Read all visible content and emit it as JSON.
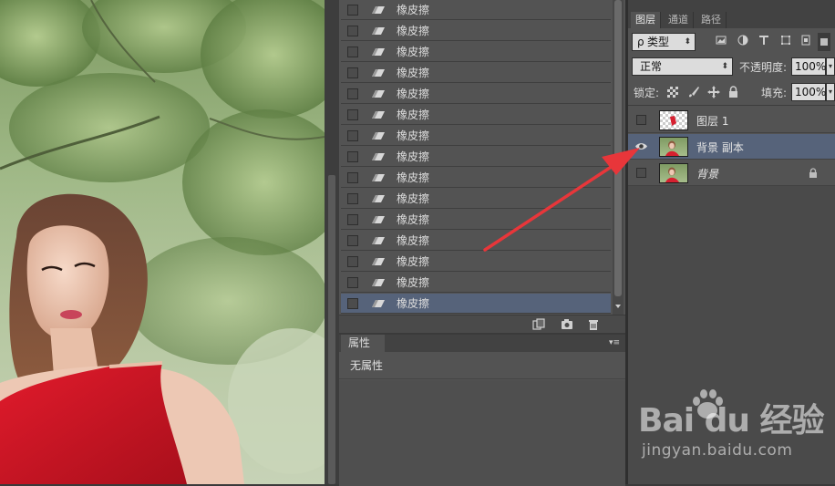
{
  "history": {
    "items": [
      {
        "label": "橡皮擦",
        "selected": false
      },
      {
        "label": "橡皮擦",
        "selected": false
      },
      {
        "label": "橡皮擦",
        "selected": false
      },
      {
        "label": "橡皮擦",
        "selected": false
      },
      {
        "label": "橡皮擦",
        "selected": false
      },
      {
        "label": "橡皮擦",
        "selected": false
      },
      {
        "label": "橡皮擦",
        "selected": false
      },
      {
        "label": "橡皮擦",
        "selected": false
      },
      {
        "label": "橡皮擦",
        "selected": false
      },
      {
        "label": "橡皮擦",
        "selected": false
      },
      {
        "label": "橡皮擦",
        "selected": false
      },
      {
        "label": "橡皮擦",
        "selected": false
      },
      {
        "label": "橡皮擦",
        "selected": false
      },
      {
        "label": "橡皮擦",
        "selected": false
      },
      {
        "label": "橡皮擦",
        "selected": true
      }
    ],
    "footer_icons": [
      "new-document-from-state-icon",
      "snapshot-camera-icon",
      "trash-icon"
    ]
  },
  "properties": {
    "tab_label": "属性",
    "body_text": "无属性"
  },
  "layers": {
    "tabs": [
      {
        "label": "图层",
        "active": true
      },
      {
        "label": "通道",
        "active": false
      },
      {
        "label": "路径",
        "active": false
      }
    ],
    "filter_kind": "类型",
    "filter_prefix": "ρ",
    "blend_mode": "正常",
    "opacity_label": "不透明度:",
    "opacity_value": "100%",
    "lock_label": "锁定:",
    "fill_label": "填充:",
    "fill_value": "100%",
    "items": [
      {
        "name": "图层 1",
        "visible": false,
        "thumb": "transparent",
        "locked": false,
        "italic": false,
        "selected": false
      },
      {
        "name": "背景 副本",
        "visible": true,
        "thumb": "photo",
        "locked": false,
        "italic": false,
        "selected": true
      },
      {
        "name": "背景",
        "visible": false,
        "thumb": "photo",
        "locked": true,
        "italic": true,
        "selected": false
      }
    ]
  },
  "watermark": {
    "logo": "Bai du 经验",
    "url": "jingyan.baidu.com"
  },
  "colors": {
    "panel": "#535353",
    "selection": "#56637a",
    "annotation_arrow": "#e8363a"
  }
}
